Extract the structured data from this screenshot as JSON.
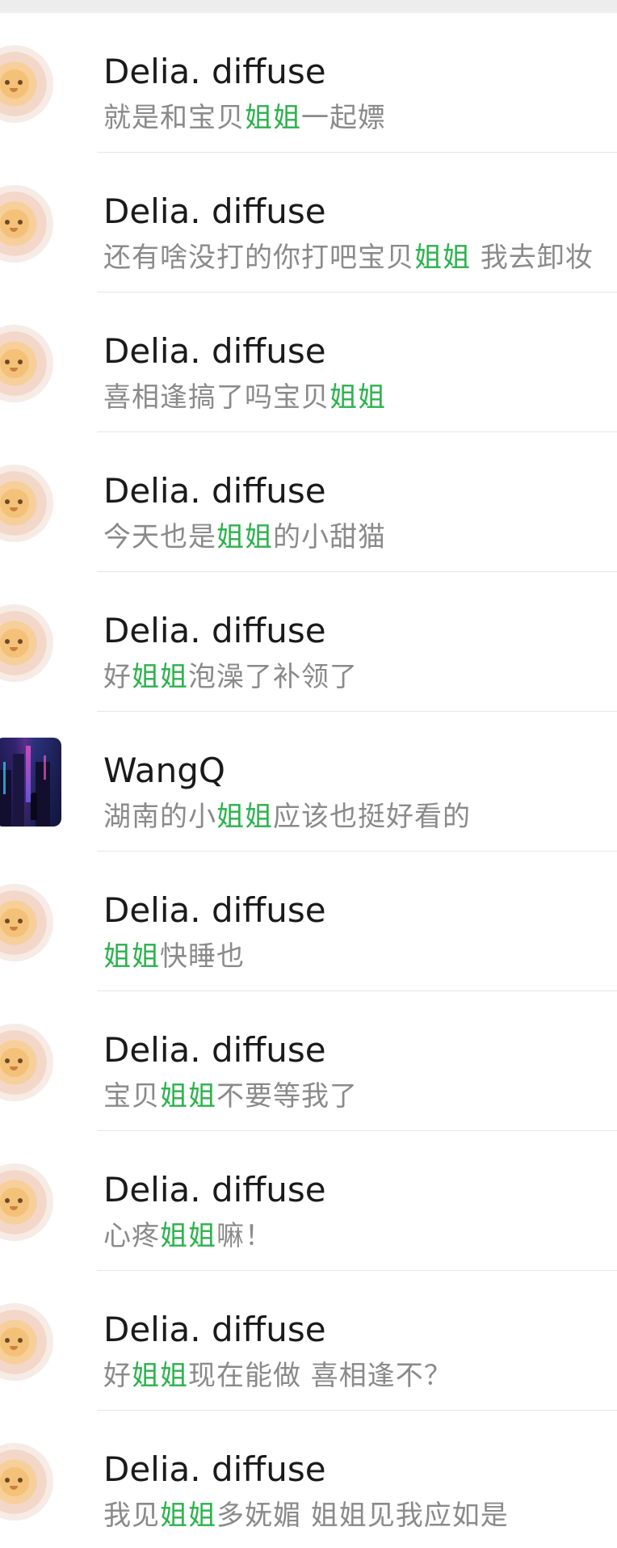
{
  "colors": {
    "highlight": "#2bb24c",
    "name_text": "#1a1a1a",
    "message_text": "#8a8a8a",
    "divider": "#e6e6e6",
    "top_strip": "#ededed"
  },
  "search_keyword": "姐姐",
  "results": [
    {
      "avatar": "lion-avatar",
      "name": "Delia. diffuse",
      "message": [
        {
          "text": "就是和宝贝",
          "highlight": false
        },
        {
          "text": "姐姐",
          "highlight": true
        },
        {
          "text": "一起嫖",
          "highlight": false
        }
      ]
    },
    {
      "avatar": "lion-avatar",
      "name": "Delia. diffuse",
      "message": [
        {
          "text": "还有啥没打的你打吧宝贝",
          "highlight": false
        },
        {
          "text": "姐姐",
          "highlight": true
        },
        {
          "text": " 我去卸妆",
          "highlight": false
        }
      ]
    },
    {
      "avatar": "lion-avatar",
      "name": "Delia. diffuse",
      "message": [
        {
          "text": "喜相逢搞了吗宝贝",
          "highlight": false
        },
        {
          "text": "姐姐",
          "highlight": true
        }
      ]
    },
    {
      "avatar": "lion-avatar",
      "name": "Delia. diffuse",
      "message": [
        {
          "text": "今天也是",
          "highlight": false
        },
        {
          "text": "姐姐",
          "highlight": true
        },
        {
          "text": "的小甜猫",
          "highlight": false
        }
      ]
    },
    {
      "avatar": "lion-avatar",
      "name": "Delia. diffuse",
      "message": [
        {
          "text": "好",
          "highlight": false
        },
        {
          "text": "姐姐",
          "highlight": true
        },
        {
          "text": "泡澡了补领了",
          "highlight": false
        }
      ]
    },
    {
      "avatar": "city-avatar",
      "name": "WangQ",
      "message": [
        {
          "text": "湖南的小",
          "highlight": false
        },
        {
          "text": "姐姐",
          "highlight": true
        },
        {
          "text": "应该也挺好看的",
          "highlight": false
        }
      ]
    },
    {
      "avatar": "lion-avatar",
      "name": "Delia. diffuse",
      "message": [
        {
          "text": "姐姐",
          "highlight": true
        },
        {
          "text": "快睡也",
          "highlight": false
        }
      ]
    },
    {
      "avatar": "lion-avatar",
      "name": "Delia. diffuse",
      "message": [
        {
          "text": "宝贝",
          "highlight": false
        },
        {
          "text": "姐姐",
          "highlight": true
        },
        {
          "text": "不要等我了",
          "highlight": false
        }
      ]
    },
    {
      "avatar": "lion-avatar",
      "name": "Delia. diffuse",
      "message": [
        {
          "text": "心疼",
          "highlight": false
        },
        {
          "text": "姐姐",
          "highlight": true
        },
        {
          "text": "嘛！",
          "highlight": false
        }
      ]
    },
    {
      "avatar": "lion-avatar",
      "name": "Delia. diffuse",
      "message": [
        {
          "text": "好",
          "highlight": false
        },
        {
          "text": "姐姐",
          "highlight": true
        },
        {
          "text": "现在能做 喜相逢不？",
          "highlight": false
        }
      ]
    },
    {
      "avatar": "lion-avatar",
      "name": "Delia. diffuse",
      "message": [
        {
          "text": "我见",
          "highlight": false
        },
        {
          "text": "姐姐",
          "highlight": true
        },
        {
          "text": "多妩媚 姐姐见我应如是",
          "highlight": false
        }
      ]
    }
  ]
}
